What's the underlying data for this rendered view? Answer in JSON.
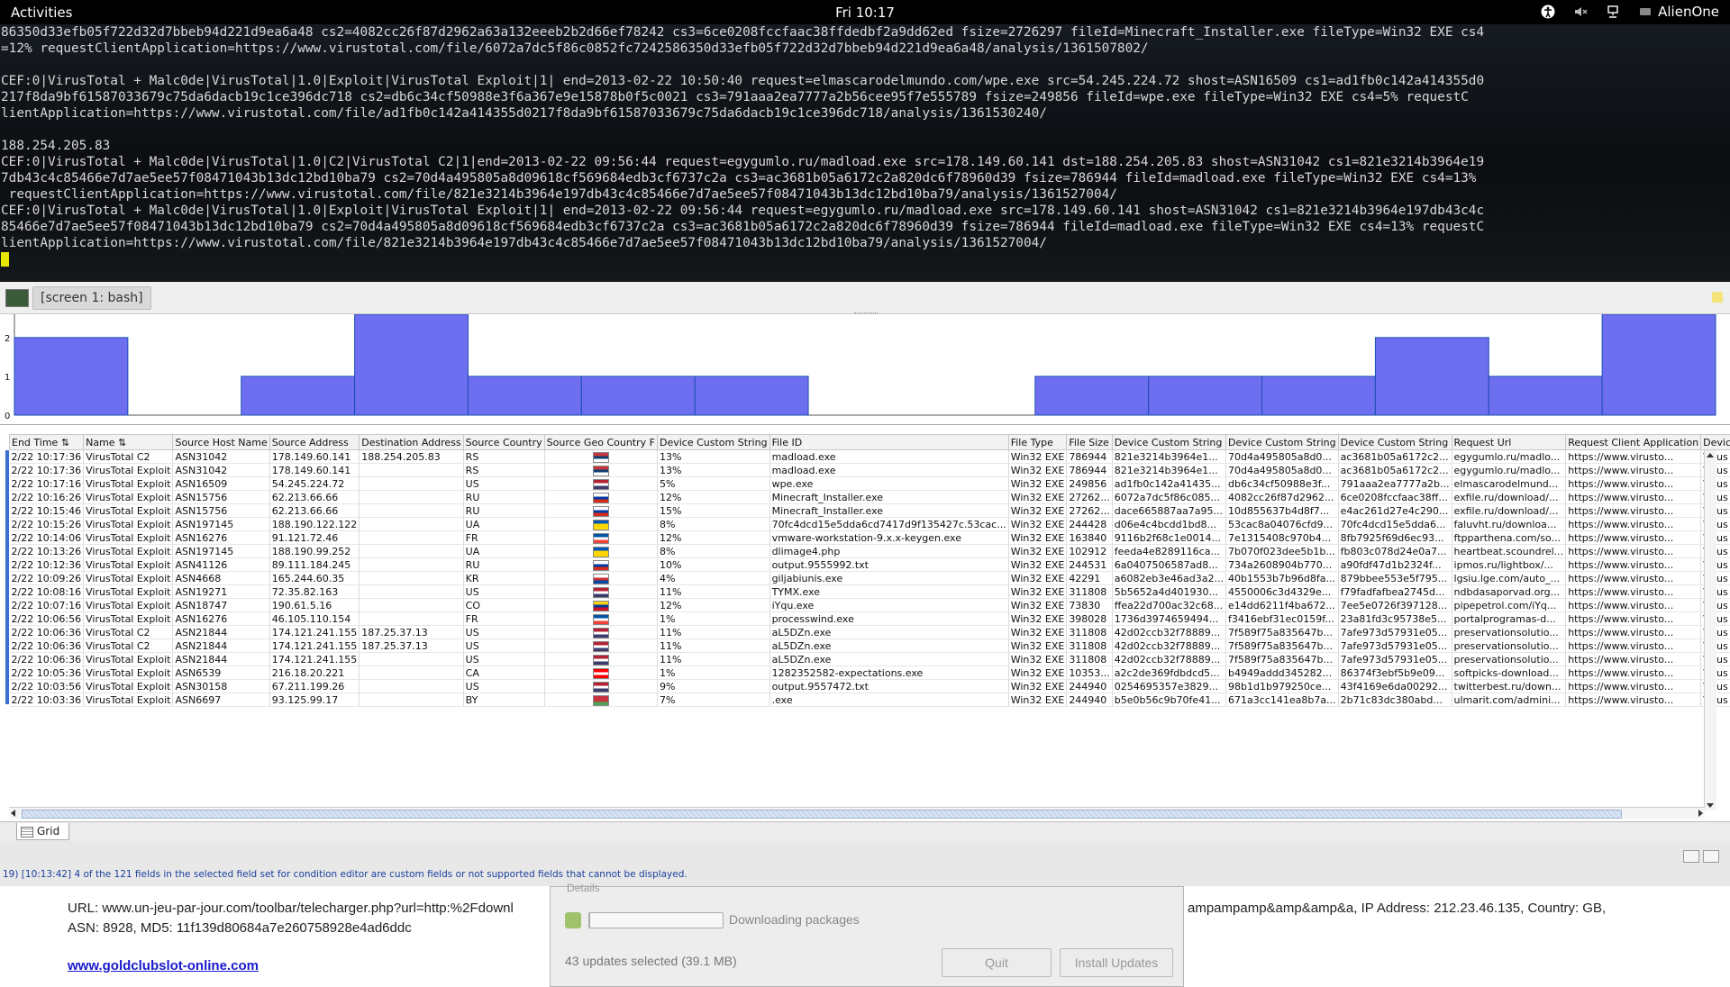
{
  "topbar": {
    "activities": "Activities",
    "clock": "Fri 10:17",
    "user": "AlienOne"
  },
  "terminal": {
    "lines": [
      "86350d33efb05f722d32d7bbeb94d221d9ea6a48 cs2=4082cc26f87d2962a63a132eeeb2b2d66ef78242 cs3=6ce0208fccfaac38ffdedbf2a9dd62ed fsize=2726297 fileId=Minecraft_Installer.exe fileType=Win32 EXE cs4",
      "=12% requestClientApplication=https://www.virustotal.com/file/6072a7dc5f86c0852fc7242586350d33efb05f722d32d7bbeb94d221d9ea6a48/analysis/1361507802/",
      "",
      "CEF:0|VirusTotal + Malc0de|VirusTotal|1.0|Exploit|VirusTotal Exploit|1| end=2013-02-22 10:50:40 request=elmascarodelmundo.com/wpe.exe src=54.245.224.72 shost=ASN16509 cs1=ad1fb0c142a414355d0",
      "217f8da9bf61587033679c75da6dacb19c1ce396dc718 cs2=db6c34cf50988e3f6a367e9e15878b0f5c0021 cs3=791aaa2ea7777a2b56cee95f7e555789 fsize=249856 fileId=wpe.exe fileType=Win32 EXE cs4=5% requestC",
      "lientApplication=https://www.virustotal.com/file/ad1fb0c142a414355d0217f8da9bf61587033679c75da6dacb19c1ce396dc718/analysis/1361530240/",
      "",
      "188.254.205.83",
      "CEF:0|VirusTotal + Malc0de|VirusTotal|1.0|C2|VirusTotal C2|1|end=2013-02-22 09:56:44 request=egygumlo.ru/madload.exe src=178.149.60.141 dst=188.254.205.83 shost=ASN31042 cs1=821e3214b3964e19",
      "7db43c4c85466e7d7ae5ee57f08471043b13dc12bd10ba79 cs2=70d4a495805a8d09618cf569684edb3cf6737c2a cs3=ac3681b05a6172c2a820dc6f78960d39 fsize=786944 fileId=madload.exe fileType=Win32 EXE cs4=13%",
      " requestClientApplication=https://www.virustotal.com/file/821e3214b3964e197db43c4c85466e7d7ae5ee57f08471043b13dc12bd10ba79/analysis/1361527004/",
      "CEF:0|VirusTotal + Malc0de|VirusTotal|1.0|Exploit|VirusTotal Exploit|1| end=2013-02-22 09:56:44 request=egygumlo.ru/madload.exe src=178.149.60.141 shost=ASN31042 cs1=821e3214b3964e197db43c4c",
      "85466e7d7ae5ee57f08471043b13dc12bd10ba79 cs2=70d4a495805a8d09618cf569684edb3cf6737c2a cs3=ac3681b05a6172c2a820dc6f78960d39 fsize=786944 fileId=madload.exe fileType=Win32 EXE cs4=13% requestC",
      "lientApplication=https://www.virustotal.com/file/821e3214b3964e197db43c4c85466e7d7ae5ee57f08471043b13dc12bd10ba79/analysis/1361527004/"
    ]
  },
  "termtabs": {
    "tab_label": "[screen 1: bash]"
  },
  "chart_data": {
    "type": "bar",
    "y_ticks": [
      "0",
      "1",
      "2"
    ],
    "ylim": [
      0,
      2.6
    ],
    "values": [
      2,
      0,
      1,
      3,
      1,
      1,
      1,
      0,
      0,
      1,
      1,
      1,
      2,
      1,
      3
    ],
    "bar_color": "#6e6ef0",
    "edge_color": "#1b4fb0"
  },
  "grid": {
    "columns": [
      "End Time",
      "Name",
      "Source Host Name",
      "Source Address",
      "Destination Address",
      "Source Country",
      "Source Geo Country F",
      "Device Custom String",
      "File ID",
      "File Type",
      "File Size",
      "Device Custom String",
      "Device Custom String",
      "Device Custom String",
      "Request Url",
      "Request Client Application",
      "Devic"
    ],
    "rows": [
      [
        "2/22 10:17:36",
        "VirusTotal C2",
        "ASN31042",
        "178.149.60.141",
        "188.254.205.83",
        "RS",
        "RS",
        "13%",
        "madload.exe",
        "Win32 EXE",
        "786944",
        "821e3214b3964e1...",
        "70d4a495805a8d0...",
        "ac3681b05a6172c2...",
        "egygumlo.ru/madlo...",
        "https://www.virusto...",
        "Virus"
      ],
      [
        "2/22 10:17:36",
        "VirusTotal Exploit",
        "ASN31042",
        "178.149.60.141",
        "",
        "RS",
        "RS",
        "13%",
        "madload.exe",
        "Win32 EXE",
        "786944",
        "821e3214b3964e1...",
        "70d4a495805a8d0...",
        "ac3681b05a6172c2...",
        "egygumlo.ru/madlo...",
        "https://www.virusto...",
        "Virus"
      ],
      [
        "2/22 10:17:16",
        "VirusTotal Exploit",
        "ASN16509",
        "54.245.224.72",
        "",
        "US",
        "US",
        "5%",
        "wpe.exe",
        "Win32 EXE",
        "249856",
        "ad1fb0c142a41435...",
        "db6c34cf50988e3f...",
        "791aaa2ea7777a2b...",
        "elmascarodelmund...",
        "https://www.virusto...",
        "Virus"
      ],
      [
        "2/22 10:16:26",
        "VirusTotal Exploit",
        "ASN15756",
        "62.213.66.66",
        "",
        "RU",
        "RU",
        "12%",
        "Minecraft_Installer.exe",
        "Win32 EXE",
        "27262...",
        "6072a7dc5f86c085...",
        "4082cc26f87d2962...",
        "6ce0208fccfaac38ff...",
        "exfile.ru/download/...",
        "https://www.virusto...",
        "Virus"
      ],
      [
        "2/22 10:15:46",
        "VirusTotal Exploit",
        "ASN15756",
        "62.213.66.66",
        "",
        "RU",
        "RU",
        "15%",
        "Minecraft_Installer.exe",
        "Win32 EXE",
        "27262...",
        "dace665887aa7a95...",
        "10d855637b4d8f7...",
        "e4ac261d27e4c290...",
        "exfile.ru/download/...",
        "https://www.virusto...",
        "Virus"
      ],
      [
        "2/22 10:15:26",
        "VirusTotal Exploit",
        "ASN197145",
        "188.190.122.122",
        "",
        "UA",
        "UA",
        "8%",
        "70fc4dcd15e5dda6cd7417d9f135427c.53cac...",
        "Win32 EXE",
        "244428",
        "d06e4c4bcdd1bd8...",
        "53cac8a04076cfd9...",
        "70fc4dcd15e5dda6...",
        "faluvht.ru/downloa...",
        "https://www.virusto...",
        "Virus"
      ],
      [
        "2/22 10:14:06",
        "VirusTotal Exploit",
        "ASN16276",
        "91.121.72.46",
        "",
        "FR",
        "FR",
        "12%",
        "vmware-workstation-9.x.x-keygen.exe",
        "Win32 EXE",
        "163840",
        "9116b2f68c1e0014...",
        "7e1315408c970b4...",
        "8fb7925f69d6ec93...",
        "ftpparthena.com/so...",
        "https://www.virusto...",
        "Virus"
      ],
      [
        "2/22 10:13:26",
        "VirusTotal Exploit",
        "ASN197145",
        "188.190.99.252",
        "",
        "UA",
        "UA",
        "8%",
        "dlimage4.php",
        "Win32 EXE",
        "102912",
        "feeda4e8289116ca...",
        "7b070f023dee5b1b...",
        "fb803c078d24e0a7...",
        "heartbeat.scoundrel...",
        "https://www.virusto...",
        "Virus"
      ],
      [
        "2/22 10:12:36",
        "VirusTotal Exploit",
        "ASN41126",
        "89.111.184.245",
        "",
        "RU",
        "RU",
        "10%",
        "output.9555992.txt",
        "Win32 EXE",
        "244531",
        "6a0407506587ad8...",
        "734a2608904b770...",
        "a90fdf47d1b2324f...",
        "ipmos.ru/lightbox/...",
        "https://www.virusto...",
        "Virus"
      ],
      [
        "2/22 10:09:26",
        "VirusTotal Exploit",
        "ASN4668",
        "165.244.60.35",
        "",
        "KR",
        "KR",
        "4%",
        "giljabiunis.exe",
        "Win32 EXE",
        "42291",
        "a6082eb3e46ad3a2...",
        "40b1553b7b96d8fa...",
        "879bbee553e5f795...",
        "lgsiu.lge.com/auto_...",
        "https://www.virusto...",
        "Virus"
      ],
      [
        "2/22 10:08:16",
        "VirusTotal Exploit",
        "ASN19271",
        "72.35.82.163",
        "",
        "US",
        "US",
        "11%",
        "TYMX.exe",
        "Win32 EXE",
        "311808",
        "5b5652a4d401930...",
        "4550006c3d4329e...",
        "f79fadfafbea2745d...",
        "ndbdasaporvad.org...",
        "https://www.virusto...",
        "Virus"
      ],
      [
        "2/22 10:07:16",
        "VirusTotal Exploit",
        "ASN18747",
        "190.61.5.16",
        "",
        "CO",
        "CO",
        "12%",
        "iYqu.exe",
        "Win32 EXE",
        "73830",
        "ffea22d700ac32c68...",
        "e14dd6211f4ba672...",
        "7ee5e0726f397128...",
        "pipepetrol.com/iYq...",
        "https://www.virusto...",
        "Virus"
      ],
      [
        "2/22 10:06:56",
        "VirusTotal Exploit",
        "ASN16276",
        "46.105.110.154",
        "",
        "FR",
        "FR",
        "1%",
        "processwind.exe",
        "Win32 EXE",
        "398028",
        "1736d3974659494...",
        "f3416ebf31ec0159f...",
        "23a81fd3c95738e5...",
        "portalprogramas-d...",
        "https://www.virusto...",
        "Virus"
      ],
      [
        "2/22 10:06:36",
        "VirusTotal C2",
        "ASN21844",
        "174.121.241.155",
        "187.25.37.13",
        "US",
        "US",
        "11%",
        "aL5DZn.exe",
        "Win32 EXE",
        "311808",
        "42d02ccb32f78889...",
        "7f589f75a835647b...",
        "7afe973d57931e05...",
        "preservationsolutio...",
        "https://www.virusto...",
        "Virus"
      ],
      [
        "2/22 10:06:36",
        "VirusTotal C2",
        "ASN21844",
        "174.121.241.155",
        "187.25.37.13",
        "US",
        "US",
        "11%",
        "aL5DZn.exe",
        "Win32 EXE",
        "311808",
        "42d02ccb32f78889...",
        "7f589f75a835647b...",
        "7afe973d57931e05...",
        "preservationsolutio...",
        "https://www.virusto...",
        "Virus"
      ],
      [
        "2/22 10:06:36",
        "VirusTotal Exploit",
        "ASN21844",
        "174.121.241.155",
        "",
        "US",
        "US",
        "11%",
        "aL5DZn.exe",
        "Win32 EXE",
        "311808",
        "42d02ccb32f78889...",
        "7f589f75a835647b...",
        "7afe973d57931e05...",
        "preservationsolutio...",
        "https://www.virusto...",
        "Virus"
      ],
      [
        "2/22 10:05:36",
        "VirusTotal Exploit",
        "ASN6539",
        "216.18.20.221",
        "",
        "CA",
        "CA",
        "1%",
        "1282352582-expectations.exe",
        "Win32 EXE",
        "10353...",
        "a2c2de369fdbdcd5...",
        "b4949addd345282...",
        "86374f3ebf5b9e09...",
        "softpicks-download...",
        "https://www.virusto...",
        "Virus"
      ],
      [
        "2/22 10:03:56",
        "VirusTotal Exploit",
        "ASN30158",
        "67.211.199.26",
        "",
        "US",
        "US",
        "9%",
        "output.9557472.txt",
        "Win32 EXE",
        "244940",
        "0254695357e3829...",
        "98b1d1b979250ce...",
        "43f4169e6da00292...",
        "twitterbest.ru/down...",
        "https://www.virusto...",
        "Virus"
      ],
      [
        "2/22 10:03:36",
        "VirusTotal Exploit",
        "ASN6697",
        "93.125.99.17",
        "",
        "BY",
        "BY",
        "7%",
        ".exe",
        "Win32 EXE",
        "244940",
        "b5e0b56c9b70fe41...",
        "671a3cc141ea8b7a...",
        "2b71c83dc380abd...",
        "ulmarit.com/admini...",
        "https://www.virusto...",
        "Virus"
      ]
    ],
    "tab_label": "Grid"
  },
  "flags": {
    "RS": [
      "#c6363c",
      "#0c4076",
      "#ffffff"
    ],
    "US": [
      "#b22234",
      "#ffffff",
      "#3c3b6e"
    ],
    "RU": [
      "#ffffff",
      "#0039a6",
      "#d52b1e"
    ],
    "UA": [
      "#0057b7",
      "#ffd700",
      "#ffd700"
    ],
    "FR": [
      "#0055a4",
      "#ffffff",
      "#ef4135"
    ],
    "KR": [
      "#ffffff",
      "#cd2e3a",
      "#0047a0"
    ],
    "CO": [
      "#fcd116",
      "#003893",
      "#ce1126"
    ],
    "CA": [
      "#ff0000",
      "#ffffff",
      "#ff0000"
    ],
    "BY": [
      "#c8313e",
      "#c8313e",
      "#4aa657"
    ]
  },
  "status": {
    "message": "19) [10:13:42] 4 of the 121 fields in the selected field set for condition editor are custom fields or not supported fields that cannot be displayed."
  },
  "webpage": {
    "line1": "URL: www.un-jeu-par-jour.com/toolbar/telecharger.php?url=http:%2Fdownl",
    "line1_right": "ampampamp&amp&amp&a, IP Address: 212.23.46.135, Country: GB,",
    "line2": "ASN: 8928, MD5: 11f139d80684a7e260758928e4ad6ddc",
    "link": "www.goldclubslot-online.com"
  },
  "updater": {
    "details": "Details",
    "progress": 0,
    "status": "Downloading packages",
    "selected": "43 updates selected (39.1 MB)",
    "quit": "Quit",
    "install": "Install Updates"
  }
}
